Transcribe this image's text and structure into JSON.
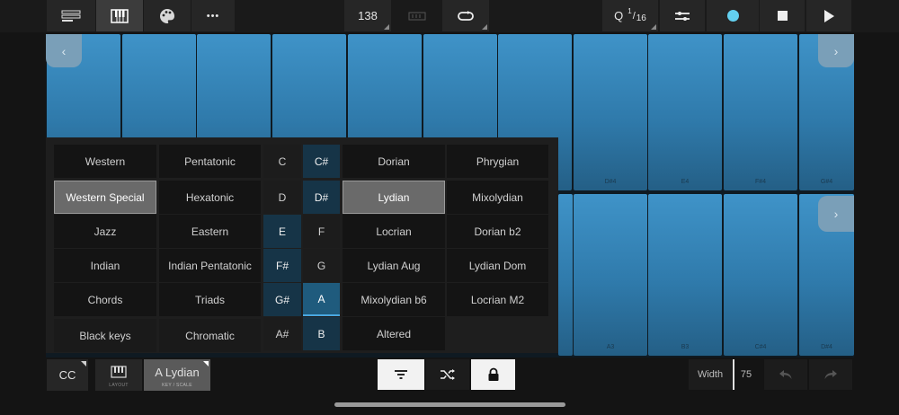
{
  "topbar": {
    "tempo": "138",
    "quantize_q": "Q",
    "quantize_num": "1",
    "quantize_den": "16",
    "menu_glyph": "•••"
  },
  "colors": {
    "pad": "#3a8cc0",
    "accent": "#63d0f0",
    "panel": "#1e1e1e"
  },
  "grid": {
    "top_labels": [
      "D#4",
      "E4",
      "F#4",
      "G#4"
    ],
    "bottom_labels": [
      "A3",
      "B3",
      "C#4",
      "D#4"
    ],
    "nav_left": "‹",
    "nav_right": "›"
  },
  "scale_panel": {
    "categories_left": [
      "Western",
      "Western Special",
      "Jazz",
      "Indian",
      "Chords",
      "Black keys"
    ],
    "categories_right": [
      "Pentatonic",
      "Hexatonic",
      "Eastern",
      "Indian Pentatonic",
      "Triads",
      "Chromatic"
    ],
    "notes_left": [
      "C",
      "D",
      "E",
      "F#",
      "G#",
      "A#"
    ],
    "notes_right": [
      "C#",
      "D#",
      "F",
      "G",
      "A",
      "B"
    ],
    "modes_left": [
      "Dorian",
      "Lydian",
      "Locrian",
      "Lydian Aug",
      "Mixolydian b6",
      "Altered"
    ],
    "modes_right": [
      "Phrygian",
      "Mixolydian",
      "Dorian b2",
      "Lydian Dom",
      "Locrian M2"
    ]
  },
  "bottombar": {
    "cc": "CC",
    "layout_sub": "LAYOUT",
    "key_scale": "A Lydian",
    "key_scale_sub": "KEY / SCALE",
    "width_label": "Width",
    "width_value": "75"
  }
}
